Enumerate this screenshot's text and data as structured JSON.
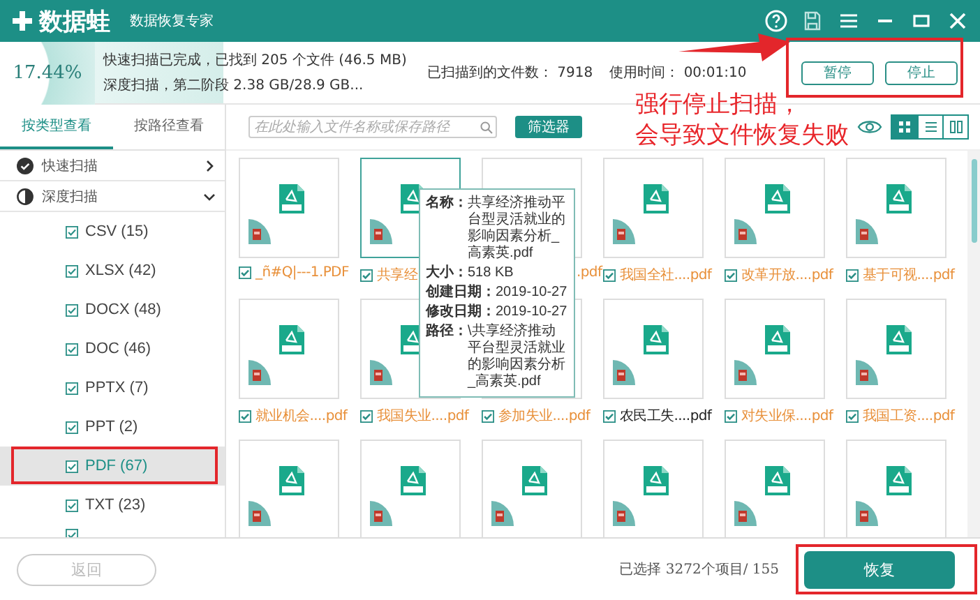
{
  "app": {
    "brand": "数据蛙",
    "subtitle": "数据恢复专家"
  },
  "scan": {
    "percent": "17.44%",
    "line_1": "快速扫描已完成，已找到 205 个文件 (46.5 MB)",
    "line_2": "深度扫描，第二阶段 2.38 GB/28.9 GB...",
    "files_found": "已扫描到的文件数： 7918",
    "elapsed": "使用时间： 00:01:10",
    "buttons": [
      "暂停",
      "停止"
    ]
  },
  "view_tabs": [
    {
      "label": "按类型查看",
      "selected": true
    },
    {
      "label": "按路径查看",
      "selected": false
    }
  ],
  "search": {
    "placeholder": "在此处输入文件名称或保存路径"
  },
  "filter_button": "筛选器",
  "view_modes": [
    {
      "kind": "grid",
      "selected": true
    },
    {
      "kind": "list",
      "selected": false
    },
    {
      "kind": "detail",
      "selected": false
    }
  ],
  "sidebar": [
    {
      "kind": "scan",
      "label": "快速扫描",
      "done": true,
      "expanded": false
    },
    {
      "kind": "scan",
      "label": "深度扫描",
      "done": false,
      "expanded": true
    },
    {
      "kind": "type",
      "label": "CSV (15)",
      "checked": true,
      "selected": false
    },
    {
      "kind": "type",
      "label": "XLSX (42)",
      "checked": true,
      "selected": false
    },
    {
      "kind": "type",
      "label": "DOCX (48)",
      "checked": true,
      "selected": false
    },
    {
      "kind": "type",
      "label": "DOC (46)",
      "checked": true,
      "selected": false
    },
    {
      "kind": "type",
      "label": "PPTX (7)",
      "checked": true,
      "selected": false
    },
    {
      "kind": "type",
      "label": "PPT (2)",
      "checked": true,
      "selected": false
    },
    {
      "kind": "type",
      "label": "PDF (67)",
      "checked": true,
      "selected": true
    },
    {
      "kind": "type",
      "label": "TXT (23)",
      "checked": true,
      "selected": false
    },
    {
      "kind": "type",
      "checked": true,
      "selected": false
    }
  ],
  "files": [
    {
      "name": "_ñ#Q|---1.PDF",
      "checked": true,
      "selected": false,
      "color": "#e8903a"
    },
    {
      "name": "共享经",
      "checked": true,
      "selected": true,
      "color": "#e8903a"
    },
    {
      "name": ".pdf",
      "selected": false,
      "color": "#e8903a",
      "covered": true,
      "thumb_covered": true
    },
    {
      "name": "我国全社....pdf",
      "checked": true,
      "selected": false,
      "color": "#e8903a"
    },
    {
      "name": "改革开放....pdf",
      "checked": true,
      "selected": false,
      "color": "#e8903a"
    },
    {
      "name": "基于可视....pdf",
      "checked": true,
      "selected": false,
      "color": "#e8903a"
    },
    {
      "name": "就业机会....pdf",
      "checked": true,
      "selected": false,
      "color": "#e8903a"
    },
    {
      "name": "我国失业....pdf",
      "checked": true,
      "selected": false,
      "color": "#e8903a"
    },
    {
      "name": "参加失业....pdf",
      "checked": true,
      "selected": false,
      "color": "#e8903a",
      "thumb_covered": true
    },
    {
      "name": "农民工失....pdf",
      "checked": true,
      "selected": false,
      "color": "#222222"
    },
    {
      "name": "对失业保....pdf",
      "checked": true,
      "selected": false,
      "color": "#e8903a"
    },
    {
      "name": "我国工资....pdf",
      "checked": true,
      "selected": false,
      "color": "#e8903a"
    },
    {
      "selected": false
    },
    {
      "selected": false
    },
    {
      "selected": false
    },
    {
      "selected": false
    },
    {
      "selected": false
    },
    {
      "selected": false
    }
  ],
  "tooltip": [
    {
      "label": "名称：",
      "value": "共享经济推动平台型灵活就业的影响因素分析_高素英.pdf"
    },
    {
      "label": "大小：",
      "value": "518 KB"
    },
    {
      "label": "创建日期：",
      "value": "2019-10-27"
    },
    {
      "label": "修改日期：",
      "value": "2019-10-27"
    },
    {
      "label": "路径：",
      "value": "\\共享经济推动平台型灵活就业的影响因素分析_高素英.pdf"
    }
  ],
  "footer": {
    "back_button": "返回",
    "status": "已选择 3272个项目/ 155",
    "recover_button": "恢复"
  },
  "annotation": {
    "lines": [
      "强行停止扫描，",
      "会导致文件恢复失败"
    ]
  }
}
